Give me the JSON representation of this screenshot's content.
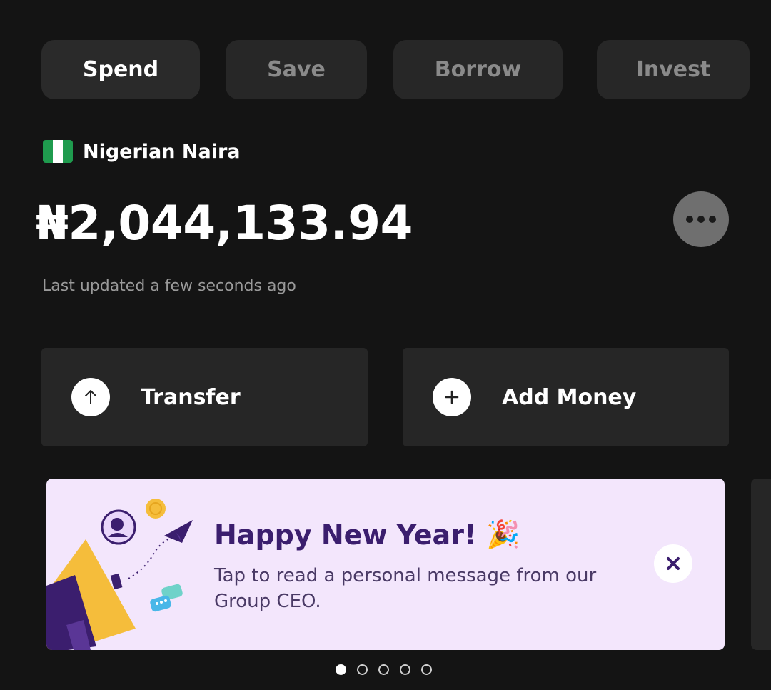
{
  "tabs": [
    {
      "label": "Spend",
      "active": true
    },
    {
      "label": "Save",
      "active": false
    },
    {
      "label": "Borrow",
      "active": false
    },
    {
      "label": "Invest",
      "active": false
    }
  ],
  "account": {
    "currency_name": "Nigerian Naira",
    "flag_icon": "nigeria-flag-icon",
    "balance": "₦2,044,133.94",
    "last_updated": "Last updated a few seconds ago"
  },
  "actions": {
    "transfer_label": "Transfer",
    "transfer_icon": "arrow-up-icon",
    "add_money_label": "Add Money",
    "add_money_icon": "plus-icon"
  },
  "banner": {
    "title": "Happy New Year!",
    "title_emoji": "🎉",
    "message": "Tap to read a personal message from our Group CEO.",
    "close_icon": "close-icon"
  },
  "pager": {
    "total": 5,
    "active_index": 0
  },
  "colors": {
    "background": "#141414",
    "card": "#262626",
    "banner_bg": "#f3e6fc",
    "banner_title": "#3b1e6e",
    "accent_yellow": "#f5bd3b",
    "accent_purple": "#3b1e6e"
  }
}
